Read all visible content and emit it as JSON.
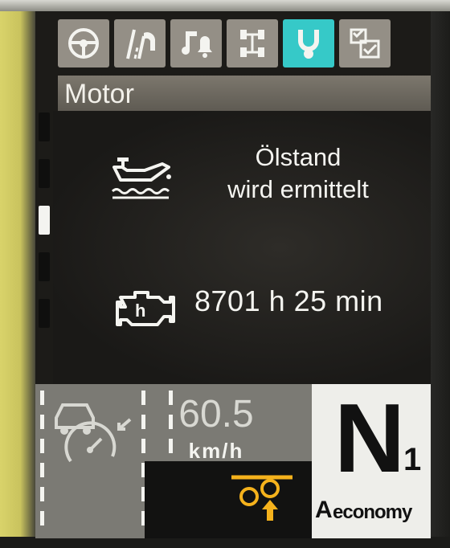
{
  "tabs": [
    {
      "icon": "steering-wheel-icon",
      "active": false
    },
    {
      "icon": "road-camera-icon",
      "active": false
    },
    {
      "icon": "music-bell-icon",
      "active": false
    },
    {
      "icon": "vehicle-chassis-icon",
      "active": false
    },
    {
      "icon": "engine-oil-icon",
      "active": true
    },
    {
      "icon": "settings-checklist-icon",
      "active": false
    }
  ],
  "section": {
    "title": "Motor"
  },
  "oil": {
    "icon": "oil-level-icon",
    "line1": "Ölstand",
    "line2": "wird ermittelt"
  },
  "engine": {
    "icon": "engine-hours-icon",
    "hours": "8701 h 25 min"
  },
  "speed": {
    "value": "60.5",
    "unit": "km/h",
    "icon": "cruise-speedometer-icon"
  },
  "gear": {
    "letter": "N",
    "number": "1",
    "mode_letter": "A",
    "mode": "economy"
  },
  "indicator": {
    "icon": "axle-lift-icon"
  },
  "colors": {
    "accent": "#36c9c8",
    "amber": "#f5b21c",
    "tab": "#948f86"
  }
}
